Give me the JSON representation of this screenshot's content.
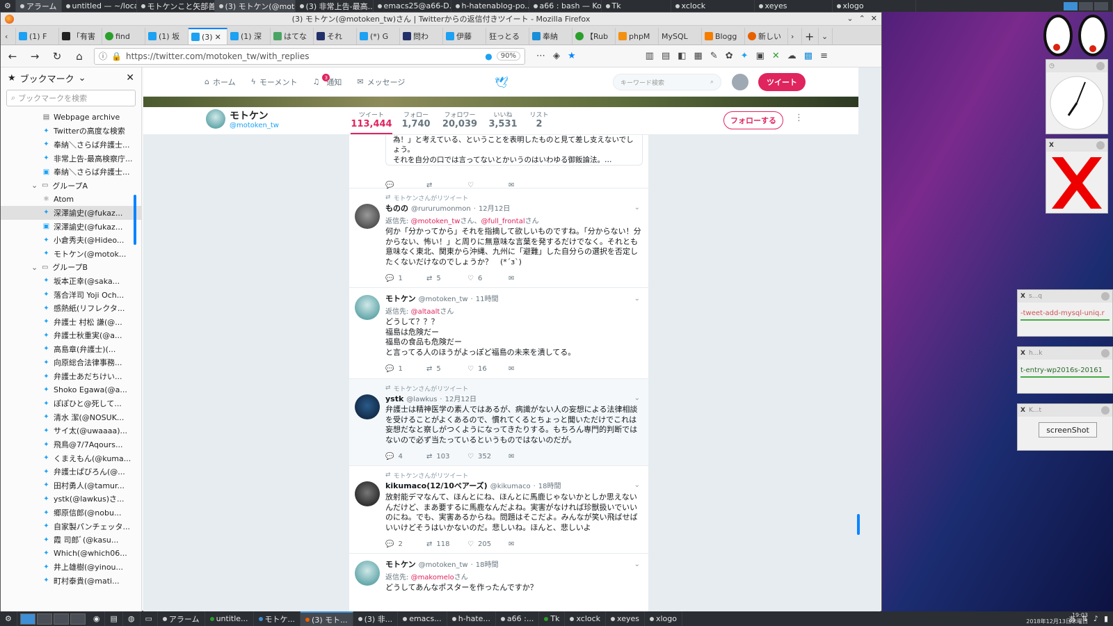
{
  "top_panel": {
    "items": [
      "アラーム",
      "untitled — ~/loca...",
      "モトケンこと矢部善...",
      "(3) モトケン(@mot...",
      "(3) 非常上告-最高...",
      "emacs25@a66-D...",
      "h-hatenablog-po...",
      "a66 : bash — Ko...",
      "Tk",
      "xclock",
      "xeyes",
      "xlogo"
    ]
  },
  "firefox": {
    "title": "(3) モトケン(@motoken_tw)さん | Twitterからの返信付きツイート - Mozilla Firefox",
    "tabs": [
      "(1) F",
      "「有害",
      "find",
      "(1) 坂",
      "(3)",
      "(1) 深",
      "はてな",
      "それ",
      "(*) G",
      "問わ",
      "伊藤",
      "狂っとる",
      "奉納",
      "【Rub",
      "phpM",
      "MySQL",
      "Blogg",
      "新しい"
    ],
    "url": "https://twitter.com/motoken_tw/with_replies",
    "zoom": "90%"
  },
  "sidebar": {
    "title": "ブックマーク",
    "search_placeholder": "ブックマークを検索",
    "items": [
      {
        "label": "Webpage archive",
        "depth": 2,
        "icon": "page"
      },
      {
        "label": "Twitterの高度な検索",
        "depth": 2,
        "icon": "twitter"
      },
      {
        "label": "奉納＼さらば弁護士...",
        "depth": 2,
        "icon": "twitter"
      },
      {
        "label": "非常上告-最高検察庁...",
        "depth": 2,
        "icon": "twitter"
      },
      {
        "label": "奉納＼さらば弁護士...",
        "depth": 2,
        "icon": "tweetdeck"
      },
      {
        "label": "グループA",
        "depth": 1,
        "icon": "folder"
      },
      {
        "label": "Atom",
        "depth": 2,
        "icon": "atom"
      },
      {
        "label": "深澤諭史(@fukaz...",
        "depth": 2,
        "icon": "twitter",
        "selected": true
      },
      {
        "label": "深澤諭史(@fukaz...",
        "depth": 2,
        "icon": "tweetdeck"
      },
      {
        "label": "小倉秀夫(@Hideo...",
        "depth": 2,
        "icon": "twitter"
      },
      {
        "label": "モトケン(@motok...",
        "depth": 2,
        "icon": "twitter"
      },
      {
        "label": "グループB",
        "depth": 1,
        "icon": "folder"
      },
      {
        "label": "坂本正幸(@saka...",
        "depth": 2,
        "icon": "twitter"
      },
      {
        "label": "落合洋司 Yoji Och...",
        "depth": 2,
        "icon": "twitter"
      },
      {
        "label": "感熱紙(リフレクタ...",
        "depth": 2,
        "icon": "twitter"
      },
      {
        "label": "弁護士 村松 謙(@...",
        "depth": 2,
        "icon": "twitter"
      },
      {
        "label": "弁護士秋重実(@a...",
        "depth": 2,
        "icon": "twitter"
      },
      {
        "label": "高島章(弁護士)(...",
        "depth": 2,
        "icon": "twitter"
      },
      {
        "label": "向原総合法律事務...",
        "depth": 2,
        "icon": "twitter"
      },
      {
        "label": "弁護士あだちけい...",
        "depth": 2,
        "icon": "twitter"
      },
      {
        "label": "Shoko Egawa(@a...",
        "depth": 2,
        "icon": "twitter"
      },
      {
        "label": "ぽぽひと@死して...",
        "depth": 2,
        "icon": "twitter"
      },
      {
        "label": "清水 潔(@NOSUK...",
        "depth": 2,
        "icon": "twitter"
      },
      {
        "label": "サイ太(@uwaaaa)...",
        "depth": 2,
        "icon": "twitter"
      },
      {
        "label": "飛鳥@7/7Aqours...",
        "depth": 2,
        "icon": "twitter"
      },
      {
        "label": "くまえもん(@kuma...",
        "depth": 2,
        "icon": "twitter"
      },
      {
        "label": "弁護士ぱびろん(@...",
        "depth": 2,
        "icon": "twitter"
      },
      {
        "label": "田村勇人(@tamur...",
        "depth": 2,
        "icon": "twitter"
      },
      {
        "label": "ystk(@lawkus)さ...",
        "depth": 2,
        "icon": "twitter"
      },
      {
        "label": "郷原信郎(@nobu...",
        "depth": 2,
        "icon": "twitter"
      },
      {
        "label": "自家製パンチェッタ...",
        "depth": 2,
        "icon": "twitter"
      },
      {
        "label": "霞 司郎ﾞ(@kasu...",
        "depth": 2,
        "icon": "twitter"
      },
      {
        "label": "Which(@which06...",
        "depth": 2,
        "icon": "twitter"
      },
      {
        "label": "井上雄樹(@yinou...",
        "depth": 2,
        "icon": "twitter"
      },
      {
        "label": "町村泰貴(@mati...",
        "depth": 2,
        "icon": "twitter"
      }
    ]
  },
  "twitter": {
    "nav": {
      "home": "ホーム",
      "moments": "モーメント",
      "notifications": "通知",
      "notif_count": "3",
      "messages": "メッセージ"
    },
    "search_placeholder": "キーワード検索",
    "tweet_button": "ツイート",
    "profile": {
      "name": "モトケン",
      "handle": "@motoken_tw",
      "follow_button": "フォローする",
      "stats": [
        {
          "label": "ツイート",
          "value": "113,444"
        },
        {
          "label": "フォロー",
          "value": "1,740"
        },
        {
          "label": "フォロワー",
          "value": "20,039"
        },
        {
          "label": "いいね",
          "value": "3,531"
        },
        {
          "label": "リスト",
          "value": "2"
        }
      ]
    },
    "quote_text": "為！」と考えている、ということを表明したものと見て差し支えないでしょう。\nそれを自分の口では言ってないとかいうのはいわゆる御飯論法。…",
    "tweets": [
      {
        "retweeted_by": "モトケンさんがリツイート",
        "name": "ものの",
        "handle": "@rururumonmon",
        "time": "12月12日",
        "reply_prefix": "返信先:",
        "reply_to": "@motoken_tw",
        "reply_mid": "さん、",
        "reply_to2": "@full_frontal",
        "reply_suffix": "さん",
        "text": "何か「分かってから」それを指摘して欲しいものですね。「分からない！分からない、怖い！」と周りに無意味な言葉を発するだけでなく。それとも意味なく東北、関東から沖縄、九州に「避難」した自分らの選択を否定したくないだけなのでしょうか？　(*´з`)",
        "replies": "1",
        "retweets": "5",
        "likes": "6"
      },
      {
        "name": "モトケン",
        "handle": "@motoken_tw",
        "time": "11時間",
        "reply_prefix": "返信先:",
        "reply_to": "@altaalt",
        "reply_suffix": "さん",
        "text": "どうして？？？\n福島は危険だー\n福島の食品も危険だー\nと言ってる人のほうがよっぽど福島の未来を潰してる。",
        "replies": "1",
        "retweets": "5",
        "likes": "16"
      },
      {
        "retweeted_by": "モトケンさんがリツイート",
        "name": "ystk",
        "handle": "@lawkus",
        "time": "12月12日",
        "text": "弁護士は精神医学の素人ではあるが、病識がない人の妄想による法律相談を受けることがよくあるので、慣れてくるとちょっと聞いただけでこれは妄想だなと察しがつくようになってきたりする。もちろん専門的判断ではないので必ず当たっているというものではないのだが。",
        "replies": "4",
        "retweets": "103",
        "likes": "352"
      },
      {
        "retweeted_by": "モトケンさんがリツイート",
        "name": "kikumaco(12/10ベアーズ)",
        "handle": "@kikumaco",
        "time": "18時間",
        "text": "放射能デマなんて、ほんとにね、ほんとに馬鹿じゃないかとしか思えないんだけど、まあ要するに馬鹿なんだよね。実害がなければ珍獣扱いでいいのにね。でも、実害あるからね。問題はそこだよ。みんなが笑い飛ばせばいいけどそうはいかないのだ。悲しいね。ほんと、悲しいよ",
        "replies": "2",
        "retweets": "118",
        "likes": "205"
      },
      {
        "name": "モトケン",
        "handle": "@motoken_tw",
        "time": "18時間",
        "reply_prefix": "返信先:",
        "reply_to": "@makomelo",
        "reply_suffix": "さん",
        "text": "どうしてあんなポスターを作ったんですか？"
      }
    ]
  },
  "widgets": {
    "xkill_title": "s...q",
    "entry1_text": "-tweet-add-mysql-uniq.r",
    "entry2_title": "h...k",
    "entry2_text": "t-entry-wp2016s-20161",
    "screenshot_title": "K...t",
    "screenshot_button": "screenShot"
  },
  "taskbar": {
    "items": [
      "アラーム",
      "untitle...",
      "モトケ...",
      "(3) モト...",
      "(3) 非...",
      "emacs...",
      "h-hate...",
      "a66 :...",
      "Tk",
      "xclock",
      "xeyes",
      "xlogo"
    ],
    "time": "19:03",
    "date": "2018年12月13日木曜日"
  },
  "colors": {
    "twitter_blue": "#1da1f2",
    "twitter_pink": "#e0245e",
    "firefox_accent": "#0a84ff"
  }
}
